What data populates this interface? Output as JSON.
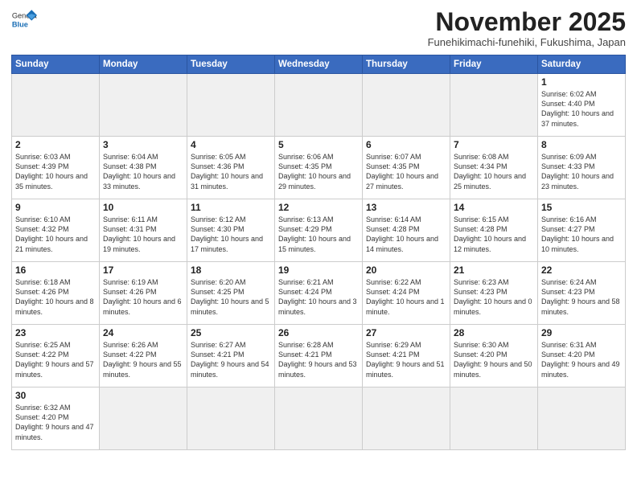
{
  "header": {
    "logo_general": "General",
    "logo_blue": "Blue",
    "month_title": "November 2025",
    "location": "Funehikimachi-funehiki, Fukushima, Japan"
  },
  "weekdays": [
    "Sunday",
    "Monday",
    "Tuesday",
    "Wednesday",
    "Thursday",
    "Friday",
    "Saturday"
  ],
  "weeks": [
    [
      {
        "day": "",
        "info": ""
      },
      {
        "day": "",
        "info": ""
      },
      {
        "day": "",
        "info": ""
      },
      {
        "day": "",
        "info": ""
      },
      {
        "day": "",
        "info": ""
      },
      {
        "day": "",
        "info": ""
      },
      {
        "day": "1",
        "info": "Sunrise: 6:02 AM\nSunset: 4:40 PM\nDaylight: 10 hours\nand 37 minutes."
      }
    ],
    [
      {
        "day": "2",
        "info": "Sunrise: 6:03 AM\nSunset: 4:39 PM\nDaylight: 10 hours\nand 35 minutes."
      },
      {
        "day": "3",
        "info": "Sunrise: 6:04 AM\nSunset: 4:38 PM\nDaylight: 10 hours\nand 33 minutes."
      },
      {
        "day": "4",
        "info": "Sunrise: 6:05 AM\nSunset: 4:36 PM\nDaylight: 10 hours\nand 31 minutes."
      },
      {
        "day": "5",
        "info": "Sunrise: 6:06 AM\nSunset: 4:35 PM\nDaylight: 10 hours\nand 29 minutes."
      },
      {
        "day": "6",
        "info": "Sunrise: 6:07 AM\nSunset: 4:35 PM\nDaylight: 10 hours\nand 27 minutes."
      },
      {
        "day": "7",
        "info": "Sunrise: 6:08 AM\nSunset: 4:34 PM\nDaylight: 10 hours\nand 25 minutes."
      },
      {
        "day": "8",
        "info": "Sunrise: 6:09 AM\nSunset: 4:33 PM\nDaylight: 10 hours\nand 23 minutes."
      }
    ],
    [
      {
        "day": "9",
        "info": "Sunrise: 6:10 AM\nSunset: 4:32 PM\nDaylight: 10 hours\nand 21 minutes."
      },
      {
        "day": "10",
        "info": "Sunrise: 6:11 AM\nSunset: 4:31 PM\nDaylight: 10 hours\nand 19 minutes."
      },
      {
        "day": "11",
        "info": "Sunrise: 6:12 AM\nSunset: 4:30 PM\nDaylight: 10 hours\nand 17 minutes."
      },
      {
        "day": "12",
        "info": "Sunrise: 6:13 AM\nSunset: 4:29 PM\nDaylight: 10 hours\nand 15 minutes."
      },
      {
        "day": "13",
        "info": "Sunrise: 6:14 AM\nSunset: 4:28 PM\nDaylight: 10 hours\nand 14 minutes."
      },
      {
        "day": "14",
        "info": "Sunrise: 6:15 AM\nSunset: 4:28 PM\nDaylight: 10 hours\nand 12 minutes."
      },
      {
        "day": "15",
        "info": "Sunrise: 6:16 AM\nSunset: 4:27 PM\nDaylight: 10 hours\nand 10 minutes."
      }
    ],
    [
      {
        "day": "16",
        "info": "Sunrise: 6:18 AM\nSunset: 4:26 PM\nDaylight: 10 hours\nand 8 minutes."
      },
      {
        "day": "17",
        "info": "Sunrise: 6:19 AM\nSunset: 4:26 PM\nDaylight: 10 hours\nand 6 minutes."
      },
      {
        "day": "18",
        "info": "Sunrise: 6:20 AM\nSunset: 4:25 PM\nDaylight: 10 hours\nand 5 minutes."
      },
      {
        "day": "19",
        "info": "Sunrise: 6:21 AM\nSunset: 4:24 PM\nDaylight: 10 hours\nand 3 minutes."
      },
      {
        "day": "20",
        "info": "Sunrise: 6:22 AM\nSunset: 4:24 PM\nDaylight: 10 hours\nand 1 minute."
      },
      {
        "day": "21",
        "info": "Sunrise: 6:23 AM\nSunset: 4:23 PM\nDaylight: 10 hours\nand 0 minutes."
      },
      {
        "day": "22",
        "info": "Sunrise: 6:24 AM\nSunset: 4:23 PM\nDaylight: 9 hours\nand 58 minutes."
      }
    ],
    [
      {
        "day": "23",
        "info": "Sunrise: 6:25 AM\nSunset: 4:22 PM\nDaylight: 9 hours\nand 57 minutes."
      },
      {
        "day": "24",
        "info": "Sunrise: 6:26 AM\nSunset: 4:22 PM\nDaylight: 9 hours\nand 55 minutes."
      },
      {
        "day": "25",
        "info": "Sunrise: 6:27 AM\nSunset: 4:21 PM\nDaylight: 9 hours\nand 54 minutes."
      },
      {
        "day": "26",
        "info": "Sunrise: 6:28 AM\nSunset: 4:21 PM\nDaylight: 9 hours\nand 53 minutes."
      },
      {
        "day": "27",
        "info": "Sunrise: 6:29 AM\nSunset: 4:21 PM\nDaylight: 9 hours\nand 51 minutes."
      },
      {
        "day": "28",
        "info": "Sunrise: 6:30 AM\nSunset: 4:20 PM\nDaylight: 9 hours\nand 50 minutes."
      },
      {
        "day": "29",
        "info": "Sunrise: 6:31 AM\nSunset: 4:20 PM\nDaylight: 9 hours\nand 49 minutes."
      }
    ],
    [
      {
        "day": "30",
        "info": "Sunrise: 6:32 AM\nSunset: 4:20 PM\nDaylight: 9 hours\nand 47 minutes."
      },
      {
        "day": "",
        "info": ""
      },
      {
        "day": "",
        "info": ""
      },
      {
        "day": "",
        "info": ""
      },
      {
        "day": "",
        "info": ""
      },
      {
        "day": "",
        "info": ""
      },
      {
        "day": "",
        "info": ""
      }
    ]
  ],
  "colors": {
    "header_bg": "#3a6bbf",
    "empty_bg": "#f0f0f0"
  }
}
